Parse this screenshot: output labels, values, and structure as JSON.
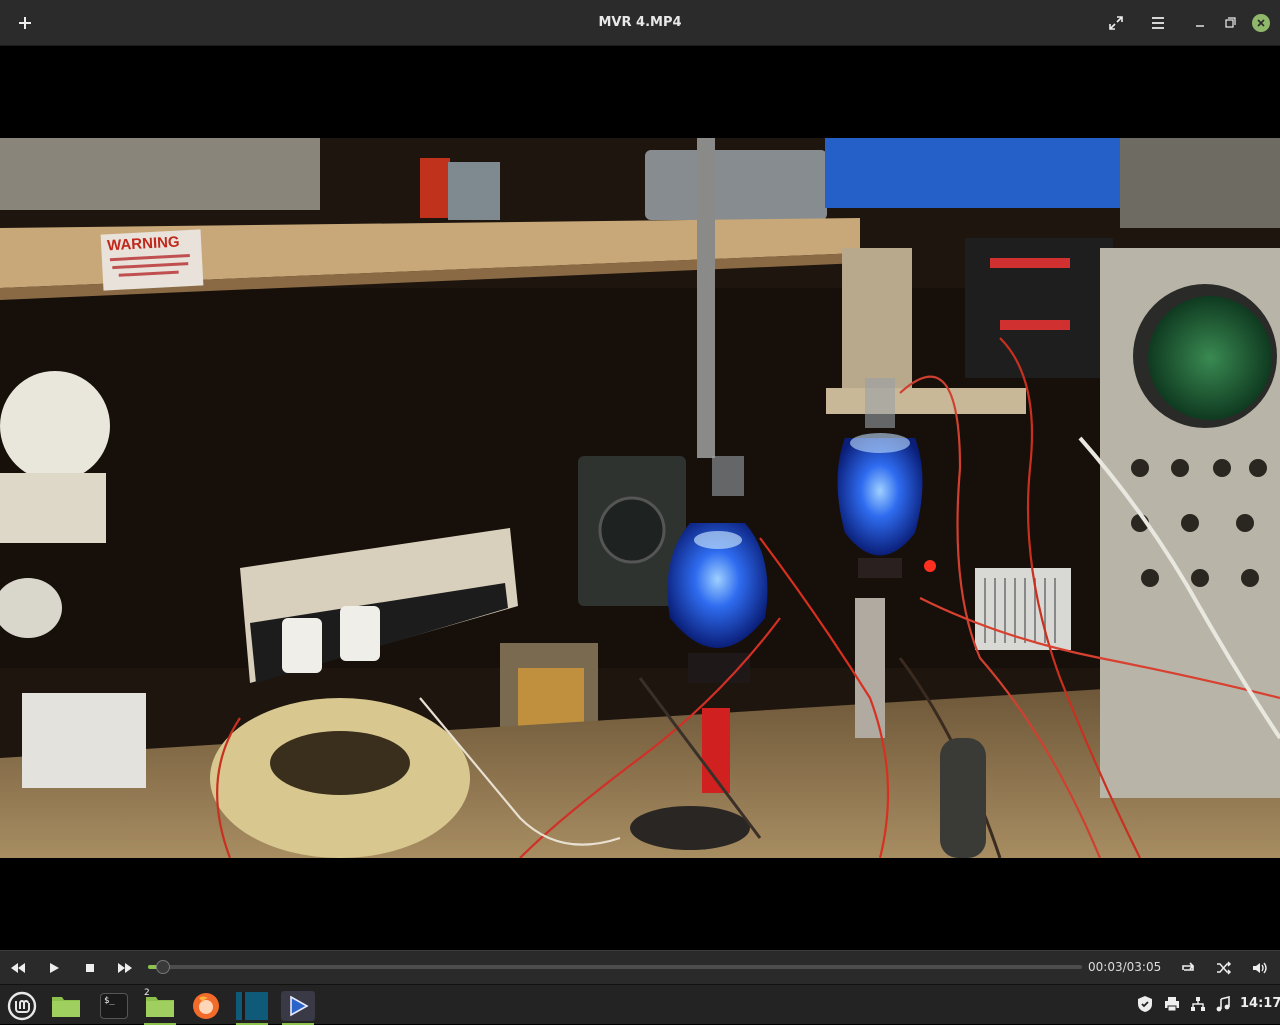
{
  "window": {
    "title": "MVR 4.MP4"
  },
  "playback": {
    "current_time": "00:03",
    "duration": "03:05",
    "progress": 0.016
  },
  "frame_text": {
    "sign_heading": "WARNING"
  },
  "taskbar": {
    "workspace_badge": "2",
    "terminal_glyph": "$_",
    "clock": "14:17"
  },
  "colors": {
    "accent": "#8cc14c",
    "close": "#8fb86b",
    "firefox": "#f26b2a",
    "vlc_blue": "#2d64c8"
  },
  "icons": {
    "titlebar": [
      "add-icon",
      "fullscreen-icon",
      "menu-icon",
      "minimize-icon",
      "maximize-icon",
      "close-icon"
    ],
    "controls": [
      "rewind-icon",
      "play-icon",
      "stop-icon",
      "fast-forward-icon",
      "repeat-icon",
      "shuffle-icon",
      "volume-icon"
    ],
    "tray": [
      "shield-icon",
      "printer-icon",
      "network-icon",
      "music-icon"
    ]
  }
}
